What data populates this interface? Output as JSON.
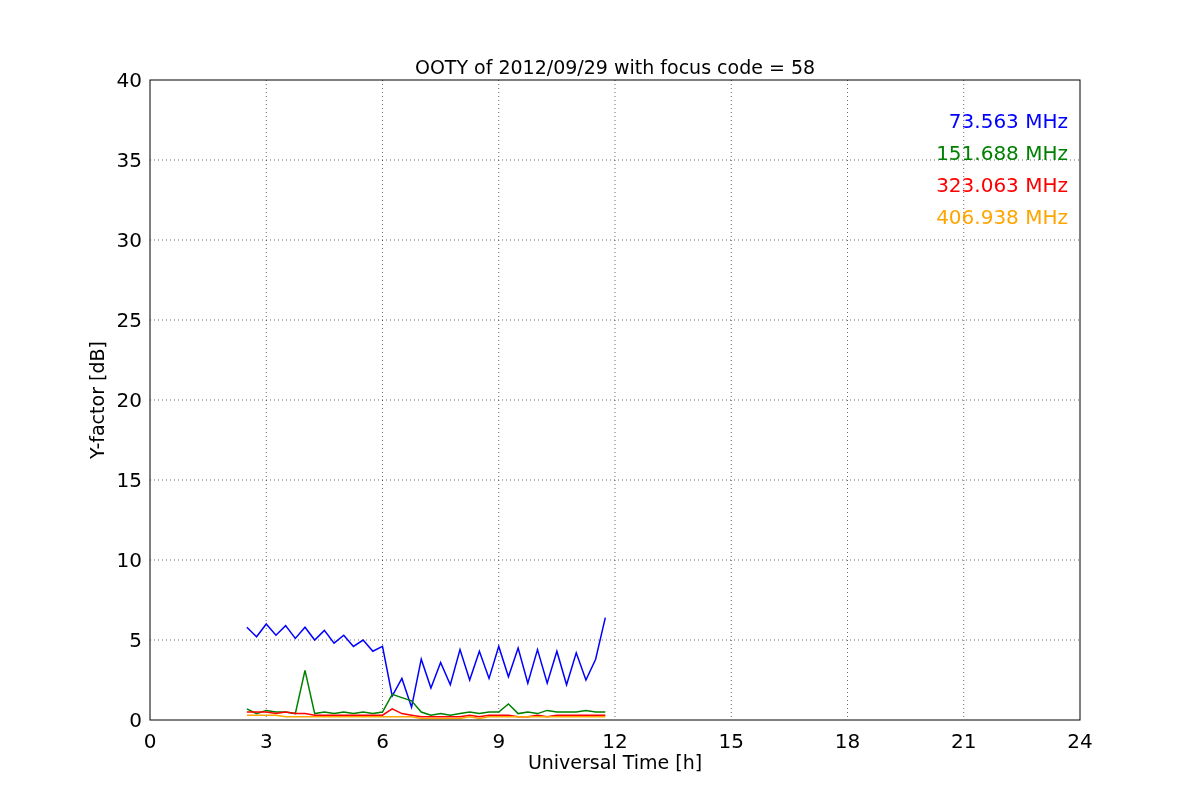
{
  "figure": {
    "chart_data": {
      "type": "line",
      "title": "OOTY of 2012/09/29 with focus code = 58",
      "xlabel": "Universal Time [h]",
      "ylabel": "Y-factor [dB]",
      "xlim": [
        0,
        24
      ],
      "ylim": [
        0,
        40
      ],
      "xticks": [
        0,
        3,
        6,
        9,
        12,
        15,
        18,
        21,
        24
      ],
      "yticks": [
        0,
        5,
        10,
        15,
        20,
        25,
        30,
        35,
        40
      ],
      "grid": true,
      "x": [
        2.5,
        2.75,
        3,
        3.25,
        3.5,
        3.75,
        4,
        4.25,
        4.5,
        4.75,
        5,
        5.25,
        5.5,
        5.75,
        6,
        6.25,
        6.5,
        6.75,
        7,
        7.25,
        7.5,
        7.75,
        8,
        8.25,
        8.5,
        8.75,
        9,
        9.25,
        9.5,
        9.75,
        10,
        10.25,
        10.5,
        10.75,
        11,
        11.25,
        11.5,
        11.75
      ],
      "series": [
        {
          "name": "73.563 MHz",
          "color": "#0000ff",
          "values": [
            5.8,
            5.2,
            6.0,
            5.3,
            5.9,
            5.1,
            5.8,
            5.0,
            5.6,
            4.8,
            5.3,
            4.6,
            5.0,
            4.3,
            4.6,
            1.5,
            2.6,
            0.8,
            3.8,
            2.0,
            3.6,
            2.2,
            4.4,
            2.5,
            4.3,
            2.6,
            4.6,
            2.7,
            4.5,
            2.3,
            4.4,
            2.3,
            4.3,
            2.2,
            4.2,
            2.5,
            3.8,
            6.4
          ]
        },
        {
          "name": "151.688 MHz",
          "color": "#008000",
          "values": [
            0.7,
            0.4,
            0.6,
            0.5,
            0.5,
            0.4,
            3.1,
            0.4,
            0.5,
            0.4,
            0.5,
            0.4,
            0.5,
            0.4,
            0.5,
            1.6,
            1.4,
            1.2,
            0.5,
            0.3,
            0.4,
            0.3,
            0.4,
            0.5,
            0.4,
            0.5,
            0.5,
            1.0,
            0.4,
            0.5,
            0.4,
            0.6,
            0.5,
            0.5,
            0.5,
            0.6,
            0.5,
            0.5
          ]
        },
        {
          "name": "323.063 MHz",
          "color": "#ff0000",
          "values": [
            0.5,
            0.5,
            0.5,
            0.4,
            0.5,
            0.4,
            0.4,
            0.3,
            0.3,
            0.3,
            0.3,
            0.3,
            0.3,
            0.3,
            0.3,
            0.7,
            0.4,
            0.3,
            0.2,
            0.2,
            0.2,
            0.2,
            0.2,
            0.3,
            0.2,
            0.3,
            0.3,
            0.3,
            0.2,
            0.2,
            0.3,
            0.2,
            0.3,
            0.3,
            0.3,
            0.3,
            0.3,
            0.3
          ]
        },
        {
          "name": "406.938 MHz",
          "color": "#ffa500",
          "values": [
            0.3,
            0.3,
            0.3,
            0.3,
            0.2,
            0.2,
            0.2,
            0.2,
            0.2,
            0.2,
            0.2,
            0.2,
            0.2,
            0.2,
            0.2,
            0.2,
            0.2,
            0.2,
            0.1,
            0.1,
            0.1,
            0.1,
            0.1,
            0.2,
            0.1,
            0.2,
            0.2,
            0.2,
            0.2,
            0.2,
            0.2,
            0.2,
            0.2,
            0.2,
            0.2,
            0.2,
            0.2,
            0.2
          ]
        }
      ]
    }
  }
}
